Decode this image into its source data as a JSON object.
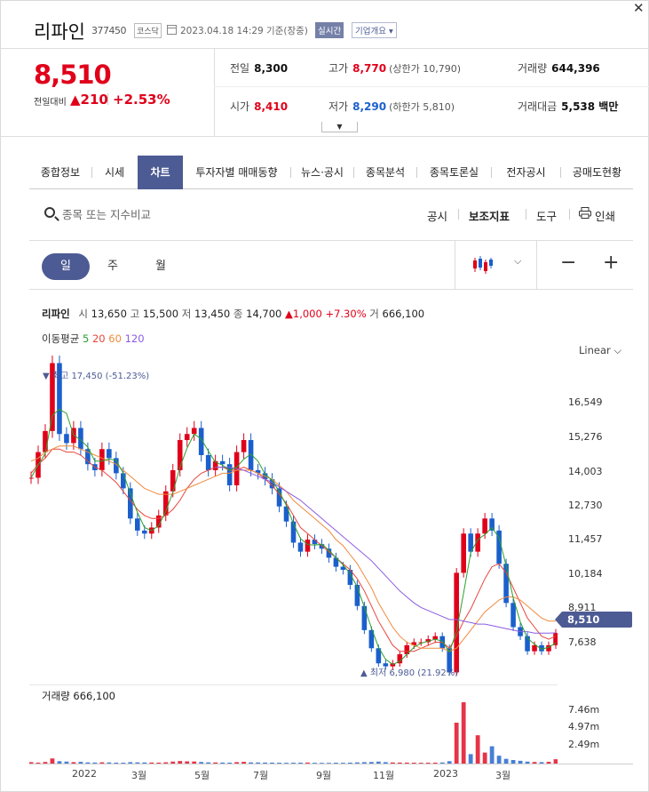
{
  "header": {
    "stock_name": "리파인",
    "code": "377450",
    "market": "코스닥",
    "datetime": "2023.04.18 14:29 기준(장중)",
    "realtime": "실시간",
    "company_btn": "기업개요 ▾"
  },
  "quote": {
    "price": "8,510",
    "prev_label": "전일대비",
    "change": "▲210",
    "pct": "+2.53%",
    "prev_close": {
      "label": "전일",
      "value": "8,300"
    },
    "open": {
      "label": "시가",
      "value": "8,410"
    },
    "high": {
      "label": "고가",
      "value": "8,770",
      "limit": "(상한가 10,790)"
    },
    "low": {
      "label": "저가",
      "value": "8,290",
      "limit": "(하한가 5,810)"
    },
    "volume": {
      "label": "거래량",
      "value": "644,396"
    },
    "amount": {
      "label": "거래대금",
      "value": "5,538 백만"
    }
  },
  "tabs": [
    "종합정보",
    "시세",
    "차트",
    "투자자별 매매동향",
    "뉴스·공시",
    "종목분석",
    "종목토론실",
    "전자공시",
    "공매도현황"
  ],
  "active_tab": 2,
  "toolbar": {
    "search_placeholder": "종목 또는 지수비교",
    "disclosure": "공시",
    "indicators": "보조지표",
    "tools": "도구",
    "print": "인쇄"
  },
  "periods": [
    "일",
    "주",
    "월"
  ],
  "active_period": 0,
  "chart_header": {
    "name": "리파인",
    "open_label": "시",
    "open": "13,650",
    "high_label": "고",
    "high": "15,500",
    "low_label": "저",
    "low": "13,450",
    "close_label": "종",
    "close": "14,700",
    "change": "▲1,000 +7.30%",
    "vol_label": "거",
    "vol": "666,100"
  },
  "ma": {
    "label": "이동평균",
    "items": [
      {
        "label": "5",
        "color": "#2ca02c"
      },
      {
        "label": "20",
        "color": "#e8453c"
      },
      {
        "label": "60",
        "color": "#f08a3c"
      },
      {
        "label": "120",
        "color": "#8c5ce0"
      }
    ]
  },
  "scale": "Linear",
  "annotations": {
    "max": "▼ 최고 17,450 (-51.23%)",
    "min": "▲ 최저 6,980 (21.92%)"
  },
  "current_price_tag": "8,510",
  "volume_title": "거래량 666,100",
  "colors": {
    "accent": "#4d5b94",
    "up": "#e0001a",
    "down": "#1a5fcc"
  },
  "chart_data": [
    {
      "type": "line",
      "title": "",
      "y_ticks": [
        "16,549",
        "15,276",
        "14,003",
        "12,730",
        "11,457",
        "10,184",
        "8,911",
        "7,638"
      ],
      "x_ticks": [
        "2022",
        "3월",
        "5월",
        "7월",
        "9월",
        "11월",
        "2023",
        "3월"
      ],
      "ylim": [
        6800,
        17700
      ],
      "series": [
        {
          "name": "",
          "values": [
            13650,
            14500,
            15200,
            17450,
            15100,
            14800,
            15300,
            14600,
            14100,
            13900,
            14600,
            14300,
            13800,
            13300,
            12300,
            11900,
            11800,
            12000,
            12400,
            13200,
            13900,
            14900,
            15100,
            15300,
            14400,
            13900,
            14200,
            14100,
            13400,
            14500,
            14900,
            13900,
            13800,
            13600,
            13300,
            12700,
            12200,
            11500,
            11200,
            11600,
            11450,
            11300,
            11000,
            10700,
            10600,
            10100,
            9400,
            8600,
            8000,
            7500,
            7400,
            7500,
            7800,
            8100,
            8200,
            8200,
            8300,
            8400,
            8000,
            7200,
            10500,
            11800,
            11200,
            11800,
            12300,
            11900,
            10800,
            9500,
            8700,
            8400,
            7900,
            8100,
            7900,
            8100,
            8510
          ]
        },
        {
          "name": "",
          "values": [
            13800,
            14100,
            14300,
            14600,
            14600,
            14500,
            14500,
            14400,
            14200,
            14000,
            13900,
            13700,
            13500,
            13200,
            12900,
            12600,
            12400,
            12300,
            12300,
            12400,
            12600,
            12900,
            13300,
            13600,
            13800,
            13900,
            14000,
            14000,
            13900,
            13900,
            14000,
            13900,
            13800,
            13600,
            13400,
            13100,
            12800,
            12400,
            12000,
            11800,
            11600,
            11400,
            11200,
            11000,
            10800,
            10600,
            10300,
            9900,
            9400,
            8900,
            8500,
            8100,
            7900,
            7900,
            7900,
            8000,
            8100,
            8200,
            8200,
            8000,
            8400,
            8900,
            9300,
            9800,
            10300,
            10700,
            10800,
            10500,
            10000,
            9500,
            9000,
            8700,
            8400,
            8300,
            8400
          ]
        },
        {
          "name": "",
          "values": [
            14200,
            14300,
            14500,
            14600,
            14700,
            14700,
            14700,
            14600,
            14500,
            14400,
            14300,
            14200,
            14100,
            13900,
            13700,
            13500,
            13300,
            13200,
            13100,
            13100,
            13100,
            13200,
            13300,
            13400,
            13500,
            13600,
            13700,
            13800,
            13800,
            13900,
            13900,
            13900,
            13800,
            13700,
            13600,
            13400,
            13200,
            12900,
            12700,
            12500,
            12300,
            12100,
            11900,
            11600,
            11400,
            11100,
            10800,
            10400,
            10000,
            9500,
            9100,
            8700,
            8400,
            8200,
            8100,
            8000,
            8000,
            8000,
            8000,
            7900,
            8000,
            8300,
            8600,
            8900,
            9200,
            9400,
            9600,
            9700,
            9700,
            9600,
            9400,
            9200,
            9000,
            8900,
            8900
          ]
        },
        {
          "name": "",
          "values": [
            null,
            null,
            null,
            null,
            null,
            null,
            null,
            null,
            null,
            null,
            null,
            null,
            null,
            null,
            null,
            null,
            null,
            null,
            null,
            null,
            null,
            null,
            null,
            null,
            null,
            null,
            14000,
            14000,
            14000,
            13950,
            13900,
            13800,
            13700,
            13600,
            13500,
            13350,
            13200,
            13050,
            12900,
            12700,
            12500,
            12300,
            12100,
            11900,
            11700,
            11500,
            11300,
            11100,
            10900,
            10650,
            10400,
            10150,
            9900,
            9700,
            9500,
            9350,
            9250,
            9150,
            9050,
            8950,
            8950,
            8900,
            8850,
            8800,
            8800,
            8750,
            8700,
            8650,
            8600,
            8550,
            8550,
            8500,
            8500,
            8500,
            8510
          ]
        }
      ]
    },
    {
      "type": "bar",
      "title": "",
      "y_ticks": [
        "7.46m",
        "4.97m",
        "2.49m"
      ],
      "ylim": [
        0,
        9500000
      ],
      "values": [
        180000,
        120000,
        200000,
        650000,
        300000,
        250000,
        180000,
        220000,
        150000,
        130000,
        160000,
        140000,
        120000,
        110000,
        180000,
        150000,
        140000,
        130000,
        120000,
        160000,
        250000,
        320000,
        280000,
        260000,
        200000,
        150000,
        140000,
        130000,
        120000,
        180000,
        220000,
        150000,
        140000,
        130000,
        120000,
        110000,
        100000,
        110000,
        120000,
        130000,
        100000,
        90000,
        90000,
        110000,
        100000,
        120000,
        150000,
        180000,
        200000,
        250000,
        180000,
        140000,
        130000,
        120000,
        110000,
        100000,
        110000,
        120000,
        140000,
        300000,
        5200000,
        7800000,
        1200000,
        3600000,
        1400000,
        2200000,
        1000000,
        600000,
        450000,
        350000,
        250000,
        200000,
        180000,
        220000,
        550000
      ]
    }
  ]
}
